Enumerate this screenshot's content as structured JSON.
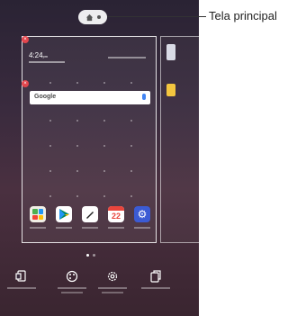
{
  "status": {
    "time": "4:24",
    "ampm": "pm"
  },
  "search": {
    "brand": "Google"
  },
  "dock": {
    "calendar_day": "22",
    "apps": [
      {
        "icon": "folder-icon"
      },
      {
        "icon": "play-store-icon"
      },
      {
        "icon": "pen-icon"
      },
      {
        "icon": "calendar-icon"
      },
      {
        "icon": "settings-gear-icon"
      }
    ]
  },
  "bottom_bar": {
    "items": [
      {
        "icon": "widgets-icon"
      },
      {
        "icon": "wallpaper-icon"
      },
      {
        "icon": "home-settings-icon"
      },
      {
        "icon": "app-icons-icon"
      }
    ]
  },
  "callout": {
    "label": "Tela principal"
  },
  "colors": {
    "background": "#3a2b3e",
    "accent_remove": "#e2454c",
    "settings_icon": "#3b5bd4"
  }
}
